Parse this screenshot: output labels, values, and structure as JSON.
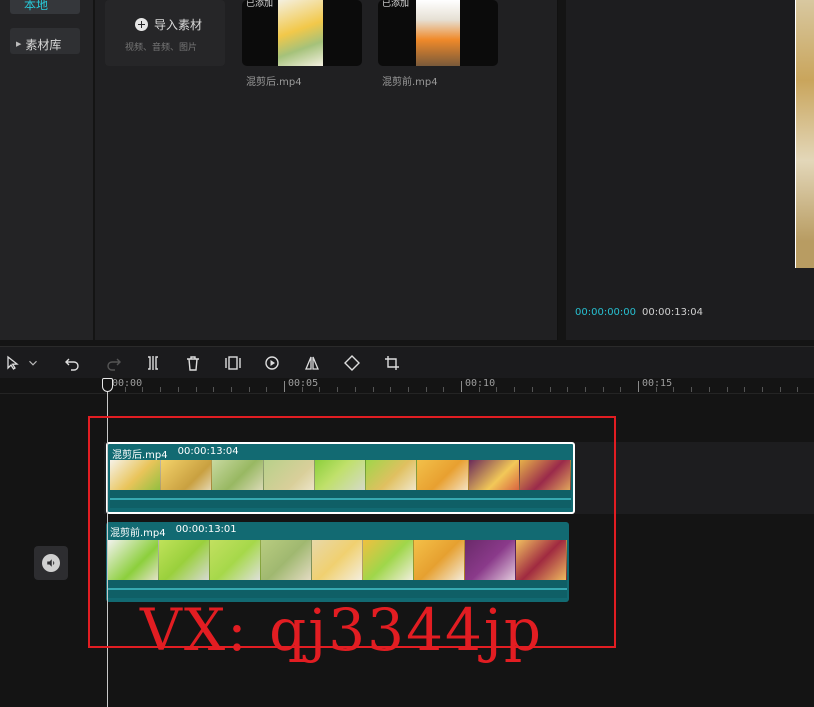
{
  "sidebar": {
    "local_label": "本地",
    "library_label": "素材库"
  },
  "media": {
    "import_label": "导入素材",
    "import_sub": "视频、音频、图片",
    "items": [
      {
        "name": "混剪后.mp4",
        "thumb_tag": "已添加"
      },
      {
        "name": "混剪前.mp4",
        "thumb_tag": "已添加"
      }
    ]
  },
  "player": {
    "current_time": "00:00:00:00",
    "total_time": "00:00:13:04"
  },
  "toolbar": {
    "tools": [
      "select-icon",
      "undo-icon",
      "redo-icon",
      "split-icon",
      "delete-icon",
      "freeze-icon",
      "speed-icon",
      "mirror-icon",
      "rotate-icon",
      "crop-icon"
    ]
  },
  "ruler": {
    "labels": [
      "00:00",
      "00:05",
      "00:10",
      "00:15"
    ]
  },
  "timeline": {
    "clips": [
      {
        "name": "混剪后.mp4",
        "duration": "00:00:13:04"
      },
      {
        "name": "混剪前.mp4",
        "duration": "00:00:13:01"
      }
    ]
  },
  "watermark": "VX: qj3344jp",
  "colors": {
    "accent": "#27bfd0",
    "clip": "#126a72",
    "annotation": "#e21d22"
  }
}
